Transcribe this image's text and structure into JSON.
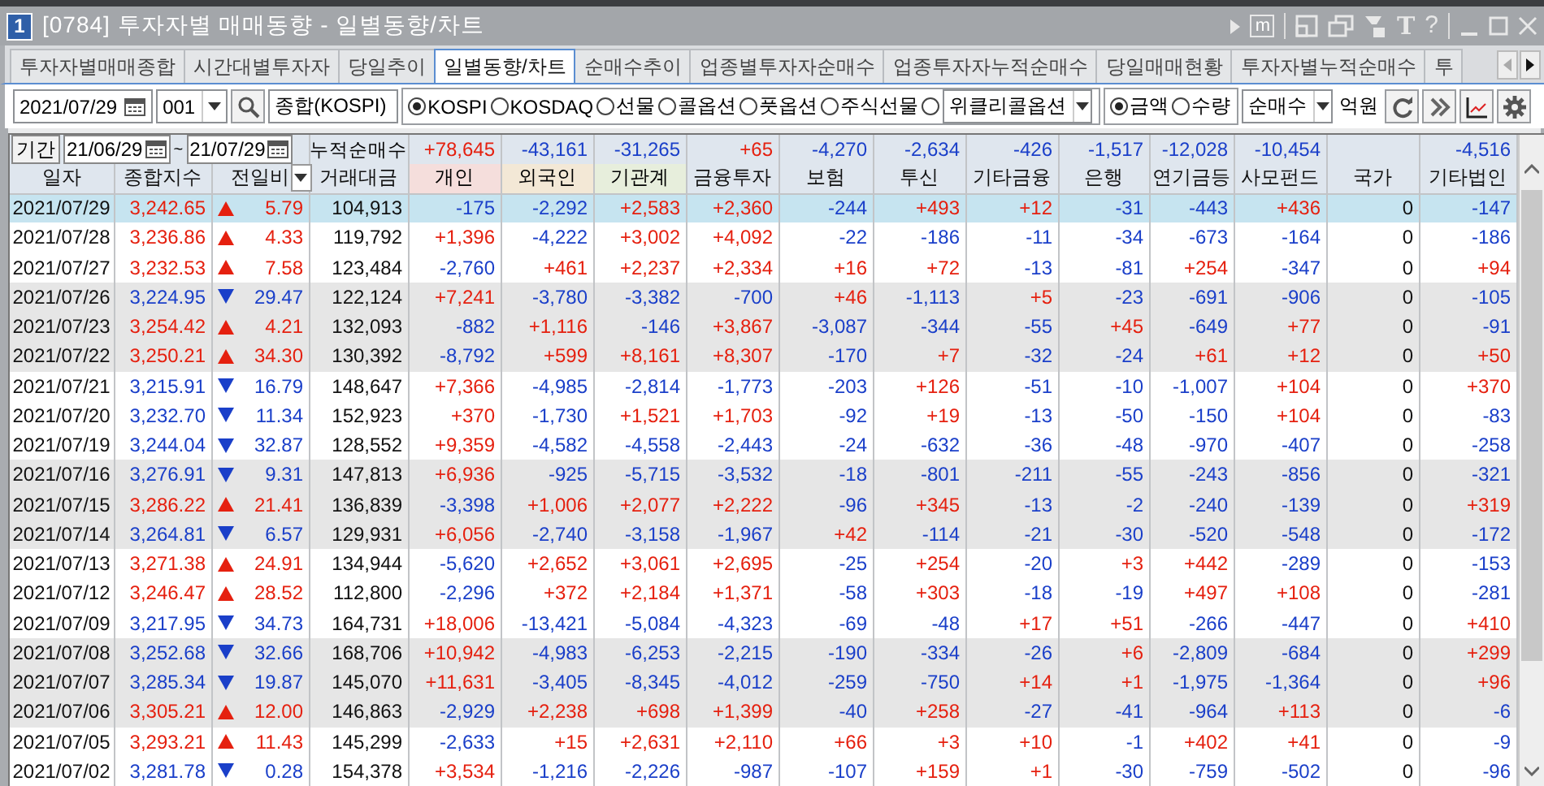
{
  "window": {
    "badge": "1",
    "title": "[0784] 투자자별 매매동향 - 일별동향/차트",
    "glyphs": {
      "memo": "m",
      "font": "T",
      "help": "?"
    }
  },
  "tabs": [
    {
      "label": "투자자별매매종합",
      "selected": false
    },
    {
      "label": "시간대별투자자",
      "selected": false
    },
    {
      "label": "당일추이",
      "selected": false
    },
    {
      "label": "일별동향/차트",
      "selected": true
    },
    {
      "label": "순매수추이",
      "selected": false
    },
    {
      "label": "업종별투자자순매수",
      "selected": false
    },
    {
      "label": "업종투자자누적순매수",
      "selected": false
    },
    {
      "label": "당일매매현황",
      "selected": false
    },
    {
      "label": "투자자별누적순매수",
      "selected": false
    },
    {
      "label": "투",
      "selected": false
    }
  ],
  "toolbar": {
    "date": "2021/07/29",
    "code": "001",
    "name": "종합(KOSPI)",
    "markets": [
      {
        "kind": "radio",
        "label": "KOSPI",
        "selected": true
      },
      {
        "kind": "radio",
        "label": "KOSDAQ",
        "selected": false
      },
      {
        "kind": "radio",
        "label": "선물",
        "selected": false
      },
      {
        "kind": "radio",
        "label": "콜옵션",
        "selected": false
      },
      {
        "kind": "radio",
        "label": "풋옵션",
        "selected": false
      },
      {
        "kind": "radio",
        "label": "주식선물",
        "selected": false
      },
      {
        "kind": "combo",
        "label": "위클리콜옵션",
        "selected": false
      }
    ],
    "units": [
      {
        "label": "금액",
        "selected": true
      },
      {
        "label": "수량",
        "selected": false
      }
    ],
    "mode": "순매수",
    "unit_label": "억원"
  },
  "period": {
    "label": "기간",
    "from": "21/06/29",
    "separator": "~",
    "to": "21/07/29",
    "total_label": "누적순매수",
    "totals": [
      {
        "kind": "value",
        "value": "+78,645"
      },
      {
        "kind": "value",
        "value": "-43,161"
      },
      {
        "kind": "value",
        "value": "-31,265"
      },
      {
        "kind": "value",
        "value": "+65"
      },
      {
        "kind": "value",
        "value": "-4,270"
      },
      {
        "kind": "value",
        "value": "-2,634"
      },
      {
        "kind": "value",
        "value": "-426"
      },
      {
        "kind": "value",
        "value": "-1,517"
      },
      {
        "kind": "value",
        "value": "-12,028"
      },
      {
        "kind": "value",
        "value": "-10,454"
      },
      {
        "kind": "blank"
      },
      {
        "kind": "value",
        "value": "-4,516"
      }
    ]
  },
  "table": {
    "columns": [
      "일자",
      "종합지수",
      "전일비",
      "거래대금",
      "개인",
      "외국인",
      "기관계",
      "금융투자",
      "보험",
      "투신",
      "기타금융",
      "은행",
      "연기금등",
      "사모펀드",
      "국가",
      "기타법인"
    ],
    "rows": [
      {
        "date": "2021/07/29",
        "index": "3,242.65",
        "kind": "up",
        "change": "5.79",
        "amount": "104,913",
        "values": [
          "-175",
          "-2,292",
          "+2,583",
          "+2,360",
          "-244",
          "+493",
          "+12",
          "-31",
          "-443",
          "+436",
          "0",
          "-147"
        ],
        "shaded": false,
        "selected": true
      },
      {
        "date": "2021/07/28",
        "index": "3,236.86",
        "kind": "up",
        "change": "4.33",
        "amount": "119,792",
        "values": [
          "+1,396",
          "-4,222",
          "+3,002",
          "+4,092",
          "-22",
          "-186",
          "-11",
          "-34",
          "-673",
          "-164",
          "0",
          "-186"
        ],
        "shaded": false,
        "selected": false
      },
      {
        "date": "2021/07/27",
        "index": "3,232.53",
        "kind": "up",
        "change": "7.58",
        "amount": "123,484",
        "values": [
          "-2,760",
          "+461",
          "+2,237",
          "+2,334",
          "+16",
          "+72",
          "-13",
          "-81",
          "+254",
          "-347",
          "0",
          "+94"
        ],
        "shaded": false,
        "selected": false
      },
      {
        "date": "2021/07/26",
        "index": "3,224.95",
        "kind": "down",
        "change": "29.47",
        "amount": "122,124",
        "values": [
          "+7,241",
          "-3,780",
          "-3,382",
          "-700",
          "+46",
          "-1,113",
          "+5",
          "-23",
          "-691",
          "-906",
          "0",
          "-105"
        ],
        "shaded": true,
        "selected": false
      },
      {
        "date": "2021/07/23",
        "index": "3,254.42",
        "kind": "up",
        "change": "4.21",
        "amount": "132,093",
        "values": [
          "-882",
          "+1,116",
          "-146",
          "+3,867",
          "-3,087",
          "-344",
          "-55",
          "+45",
          "-649",
          "+77",
          "0",
          "-91"
        ],
        "shaded": true,
        "selected": false
      },
      {
        "date": "2021/07/22",
        "index": "3,250.21",
        "kind": "up",
        "change": "34.30",
        "amount": "130,392",
        "values": [
          "-8,792",
          "+599",
          "+8,161",
          "+8,307",
          "-170",
          "+7",
          "-32",
          "-24",
          "+61",
          "+12",
          "0",
          "+50"
        ],
        "shaded": true,
        "selected": false
      },
      {
        "date": "2021/07/21",
        "index": "3,215.91",
        "kind": "down",
        "change": "16.79",
        "amount": "148,647",
        "values": [
          "+7,366",
          "-4,985",
          "-2,814",
          "-1,773",
          "-203",
          "+126",
          "-51",
          "-10",
          "-1,007",
          "+104",
          "0",
          "+370"
        ],
        "shaded": false,
        "selected": false
      },
      {
        "date": "2021/07/20",
        "index": "3,232.70",
        "kind": "down",
        "change": "11.34",
        "amount": "152,923",
        "values": [
          "+370",
          "-1,730",
          "+1,521",
          "+1,703",
          "-92",
          "+19",
          "-13",
          "-50",
          "-150",
          "+104",
          "0",
          "-83"
        ],
        "shaded": false,
        "selected": false
      },
      {
        "date": "2021/07/19",
        "index": "3,244.04",
        "kind": "down",
        "change": "32.87",
        "amount": "128,552",
        "values": [
          "+9,359",
          "-4,582",
          "-4,558",
          "-2,443",
          "-24",
          "-632",
          "-36",
          "-48",
          "-970",
          "-407",
          "0",
          "-258"
        ],
        "shaded": false,
        "selected": false
      },
      {
        "date": "2021/07/16",
        "index": "3,276.91",
        "kind": "down",
        "change": "9.31",
        "amount": "147,813",
        "values": [
          "+6,936",
          "-925",
          "-5,715",
          "-3,532",
          "-18",
          "-801",
          "-211",
          "-55",
          "-243",
          "-856",
          "0",
          "-321"
        ],
        "shaded": true,
        "selected": false
      },
      {
        "date": "2021/07/15",
        "index": "3,286.22",
        "kind": "up",
        "change": "21.41",
        "amount": "136,839",
        "values": [
          "-3,398",
          "+1,006",
          "+2,077",
          "+2,222",
          "-96",
          "+345",
          "-13",
          "-2",
          "-240",
          "-139",
          "0",
          "+319"
        ],
        "shaded": true,
        "selected": false
      },
      {
        "date": "2021/07/14",
        "index": "3,264.81",
        "kind": "down",
        "change": "6.57",
        "amount": "129,931",
        "values": [
          "+6,056",
          "-2,740",
          "-3,158",
          "-1,967",
          "+42",
          "-114",
          "-21",
          "-30",
          "-520",
          "-548",
          "0",
          "-172"
        ],
        "shaded": true,
        "selected": false
      },
      {
        "date": "2021/07/13",
        "index": "3,271.38",
        "kind": "up",
        "change": "24.91",
        "amount": "134,944",
        "values": [
          "-5,620",
          "+2,652",
          "+3,061",
          "+2,695",
          "-25",
          "+254",
          "-20",
          "+3",
          "+442",
          "-289",
          "0",
          "-153"
        ],
        "shaded": false,
        "selected": false
      },
      {
        "date": "2021/07/12",
        "index": "3,246.47",
        "kind": "up",
        "change": "28.52",
        "amount": "112,800",
        "values": [
          "-2,296",
          "+372",
          "+2,184",
          "+1,371",
          "-58",
          "+303",
          "-18",
          "-19",
          "+497",
          "+108",
          "0",
          "-281"
        ],
        "shaded": false,
        "selected": false
      },
      {
        "date": "2021/07/09",
        "index": "3,217.95",
        "kind": "down",
        "change": "34.73",
        "amount": "164,731",
        "values": [
          "+18,006",
          "-13,421",
          "-5,084",
          "-4,323",
          "-69",
          "-48",
          "+17",
          "+51",
          "-266",
          "-447",
          "0",
          "+410"
        ],
        "shaded": false,
        "selected": false
      },
      {
        "date": "2021/07/08",
        "index": "3,252.68",
        "kind": "down",
        "change": "32.66",
        "amount": "168,706",
        "values": [
          "+10,942",
          "-4,983",
          "-6,253",
          "-2,215",
          "-190",
          "-334",
          "-26",
          "+6",
          "-2,809",
          "-684",
          "0",
          "+299"
        ],
        "shaded": true,
        "selected": false
      },
      {
        "date": "2021/07/07",
        "index": "3,285.34",
        "kind": "down",
        "change": "19.87",
        "amount": "145,070",
        "values": [
          "+11,631",
          "-3,405",
          "-8,345",
          "-4,012",
          "-259",
          "-750",
          "+14",
          "+1",
          "-1,975",
          "-1,364",
          "0",
          "+96"
        ],
        "shaded": true,
        "selected": false
      },
      {
        "date": "2021/07/06",
        "index": "3,305.21",
        "kind": "up",
        "change": "12.00",
        "amount": "146,863",
        "values": [
          "-2,929",
          "+2,238",
          "+698",
          "+1,399",
          "-40",
          "+258",
          "-27",
          "-41",
          "-964",
          "+113",
          "0",
          "-6"
        ],
        "shaded": true,
        "selected": false
      },
      {
        "date": "2021/07/05",
        "index": "3,293.21",
        "kind": "up",
        "change": "11.43",
        "amount": "145,299",
        "values": [
          "-2,633",
          "+15",
          "+2,631",
          "+2,110",
          "+66",
          "+3",
          "+10",
          "-1",
          "+402",
          "+41",
          "0",
          "-9"
        ],
        "shaded": false,
        "selected": false
      },
      {
        "date": "2021/07/02",
        "index": "3,281.78",
        "kind": "down",
        "change": "0.28",
        "amount": "154,378",
        "values": [
          "+3,534",
          "-1,216",
          "-2,226",
          "-987",
          "-107",
          "+159",
          "+1",
          "-30",
          "-759",
          "-502",
          "0",
          "-96"
        ],
        "shaded": false,
        "selected": false
      }
    ]
  }
}
